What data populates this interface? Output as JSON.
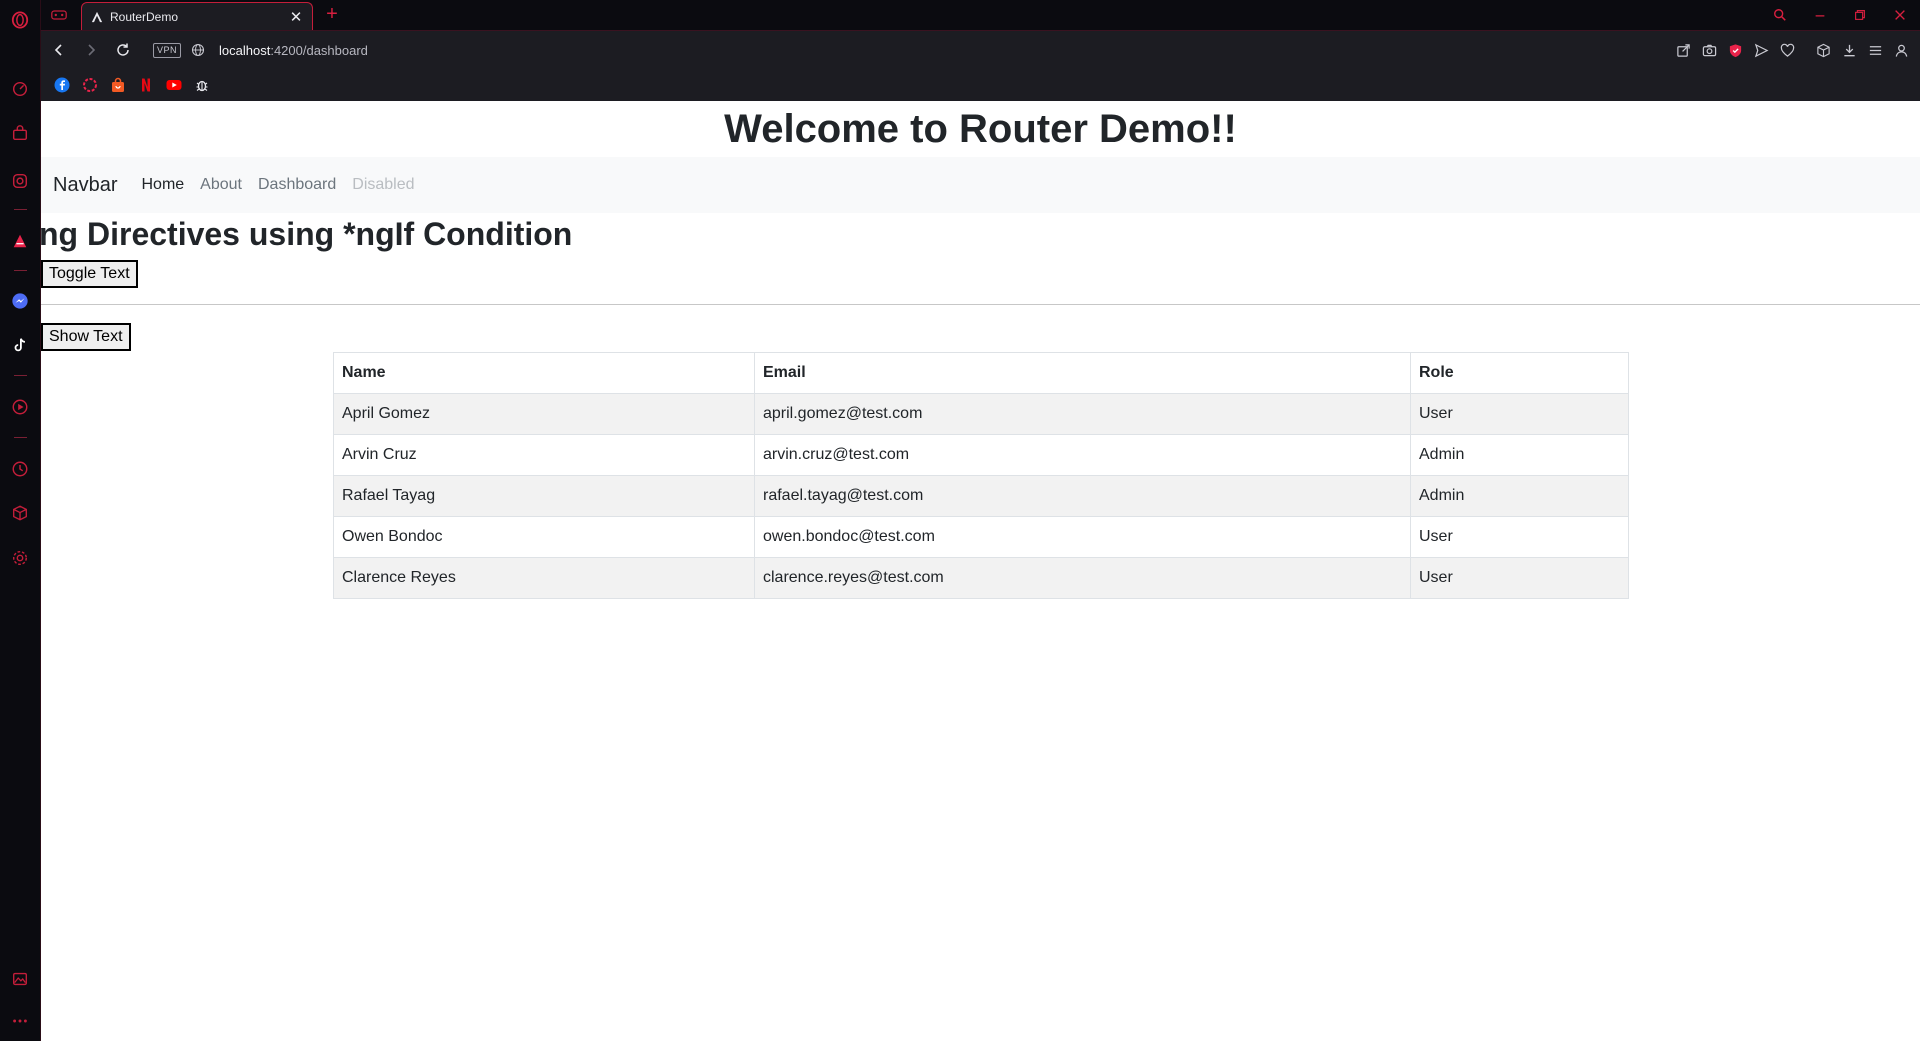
{
  "browser": {
    "tab": {
      "title": "RouterDemo"
    },
    "url": {
      "host": "localhost",
      "path": ":4200/dashboard"
    },
    "vpn_label": "VPN",
    "colors": {
      "accent": "#d81f3f",
      "chrome": "#1c1c22",
      "frame": "#0b0b10"
    }
  },
  "sidebar": {
    "icons": [
      "speed-dial-icon",
      "bag-icon",
      "instagram-icon",
      "aria-icon",
      "messenger-icon",
      "tiktok-icon",
      "player-icon",
      "history-icon",
      "cube-icon",
      "gear-icon",
      "image-icon",
      "more-icon"
    ]
  },
  "bookmarks": [
    "facebook-icon",
    "opera-icon",
    "shop-icon",
    "netflix-icon",
    "youtube-icon",
    "bug-icon"
  ],
  "page": {
    "title": "Welcome to Router Demo!!",
    "navbar": {
      "brand": "Navbar",
      "links": [
        "Home",
        "About",
        "Dashboard",
        "Disabled"
      ]
    },
    "heading": "ng Directives using *ngIf Condition",
    "toggle_button": "Toggle Text",
    "show_button": "Show Text",
    "table": {
      "headers": [
        "Name",
        "Email",
        "Role"
      ],
      "rows": [
        [
          "April Gomez",
          "april.gomez@test.com",
          "User"
        ],
        [
          "Arvin Cruz",
          "arvin.cruz@test.com",
          "Admin"
        ],
        [
          "Rafael Tayag",
          "rafael.tayag@test.com",
          "Admin"
        ],
        [
          "Owen Bondoc",
          "owen.bondoc@test.com",
          "User"
        ],
        [
          "Clarence Reyes",
          "clarence.reyes@test.com",
          "User"
        ]
      ]
    }
  }
}
